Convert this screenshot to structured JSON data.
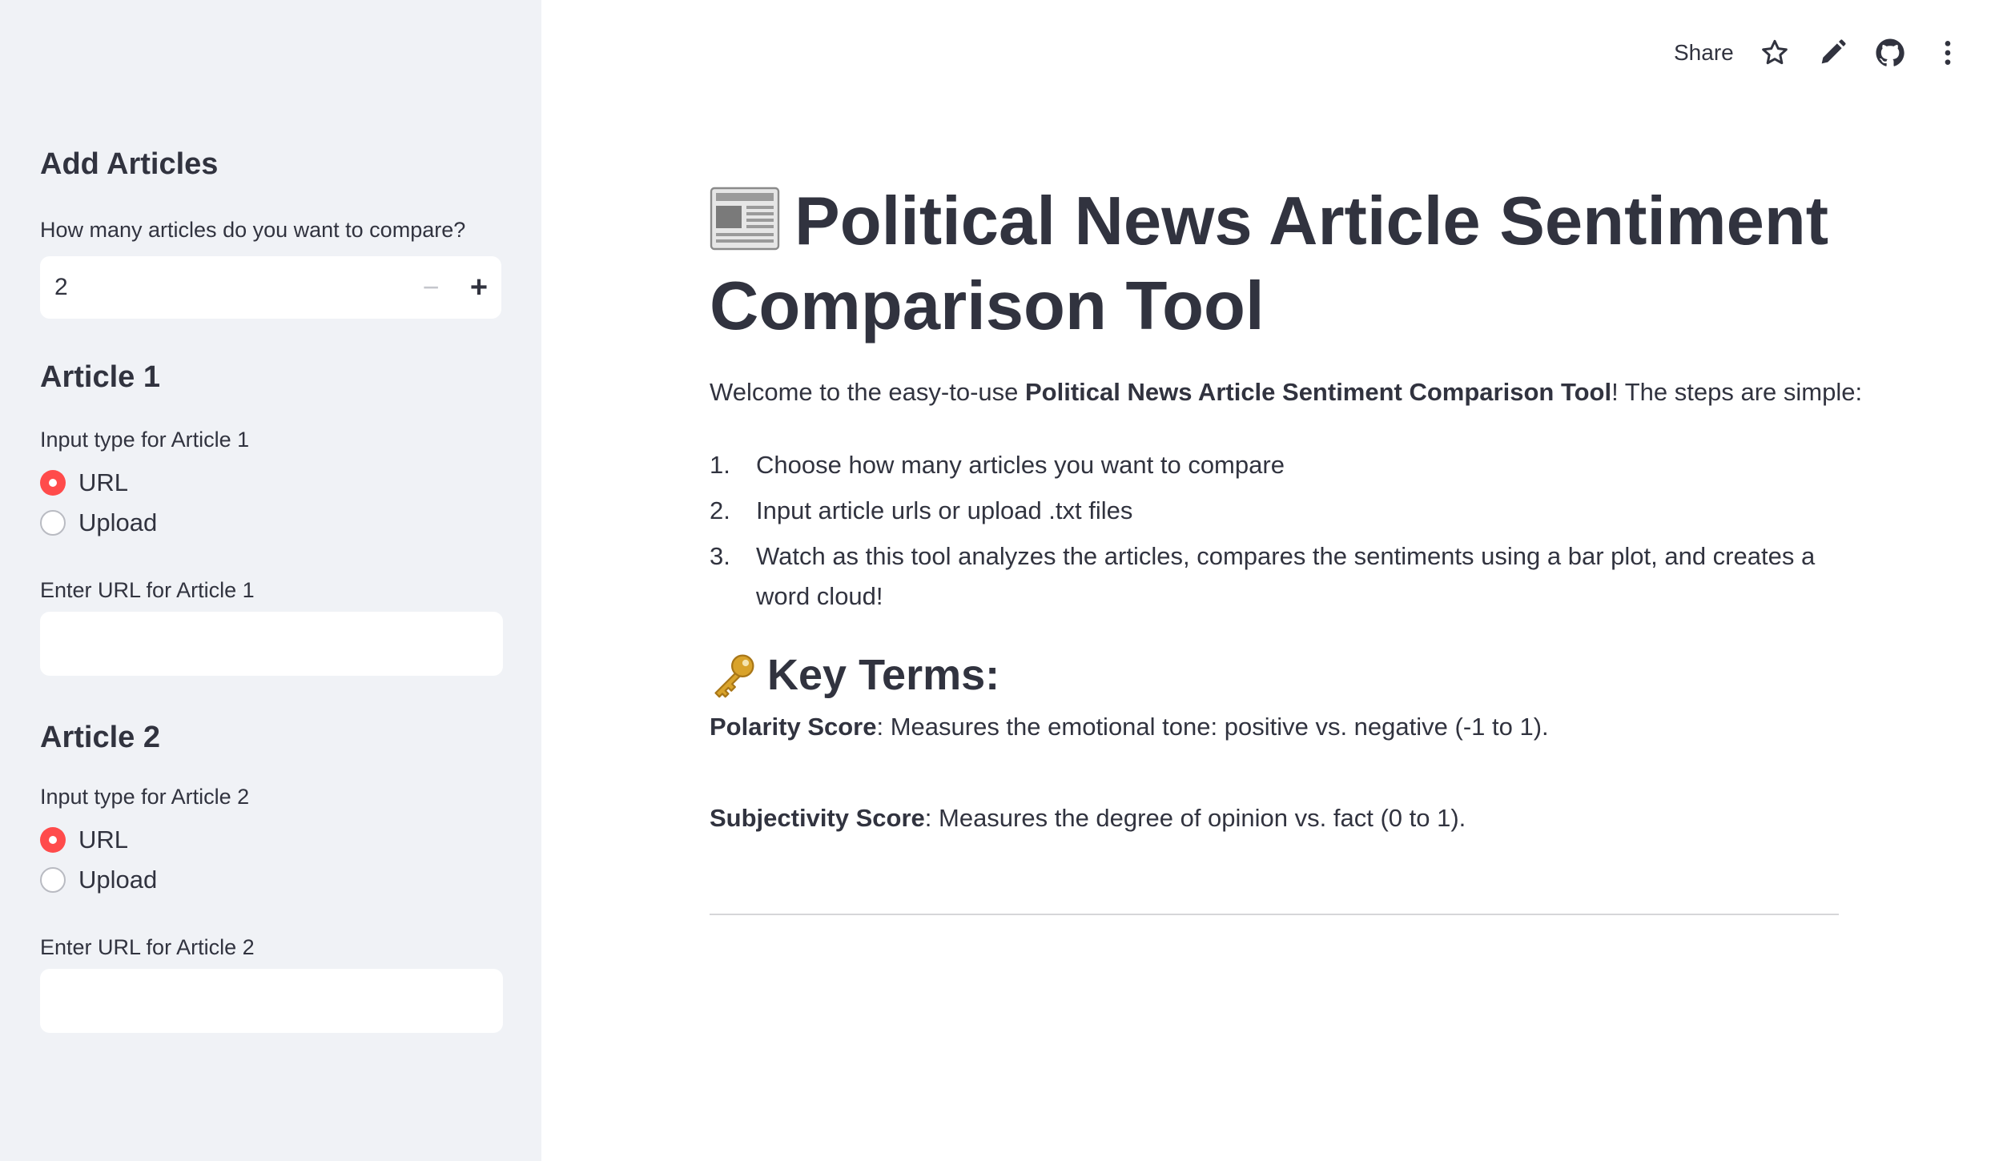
{
  "sidebar": {
    "heading": "Add Articles",
    "count_label": "How many articles do you want to compare?",
    "count_value": "2",
    "minus_label": "−",
    "plus_label": "+",
    "articles": [
      {
        "title": "Article 1",
        "input_type_label": "Input type for Article 1",
        "options": [
          "URL",
          "Upload"
        ],
        "selected": "URL",
        "url_label": "Enter URL for Article 1",
        "url_value": ""
      },
      {
        "title": "Article 2",
        "input_type_label": "Input type for Article 2",
        "options": [
          "URL",
          "Upload"
        ],
        "selected": "URL",
        "url_label": "Enter URL for Article 2",
        "url_value": ""
      }
    ]
  },
  "toolbar": {
    "share_label": "Share",
    "icons": [
      "star-icon",
      "pencil-icon",
      "github-icon",
      "more-vertical-icon"
    ]
  },
  "main": {
    "title": "Political News Article Sentiment Comparison Tool",
    "title_icon": "newspaper-icon",
    "intro_prefix": "Welcome to the easy-to-use ",
    "intro_bold": "Political News Article Sentiment Comparison Tool",
    "intro_suffix": "! The steps are simple:",
    "steps": [
      {
        "num": "1.",
        "text": "Choose how many articles you want to compare"
      },
      {
        "num": "2.",
        "text": "Input article urls or upload .txt files"
      },
      {
        "num": "3.",
        "text": "Watch as this tool analyzes the articles, compares the sentiments using a bar plot, and creates a word cloud!"
      }
    ],
    "key_terms_title": "Key Terms:",
    "key_terms_icon": "key-icon",
    "terms": [
      {
        "name": "Polarity Score",
        "desc": ": Measures the emotional tone: positive vs. negative (-1 to 1)."
      },
      {
        "name": "Subjectivity Score",
        "desc": ": Measures the degree of opinion vs. fact (0 to 1)."
      }
    ]
  },
  "colors": {
    "accent": "#ff4b4b",
    "sidebar_bg": "#f0f2f6",
    "text": "#31333f"
  }
}
